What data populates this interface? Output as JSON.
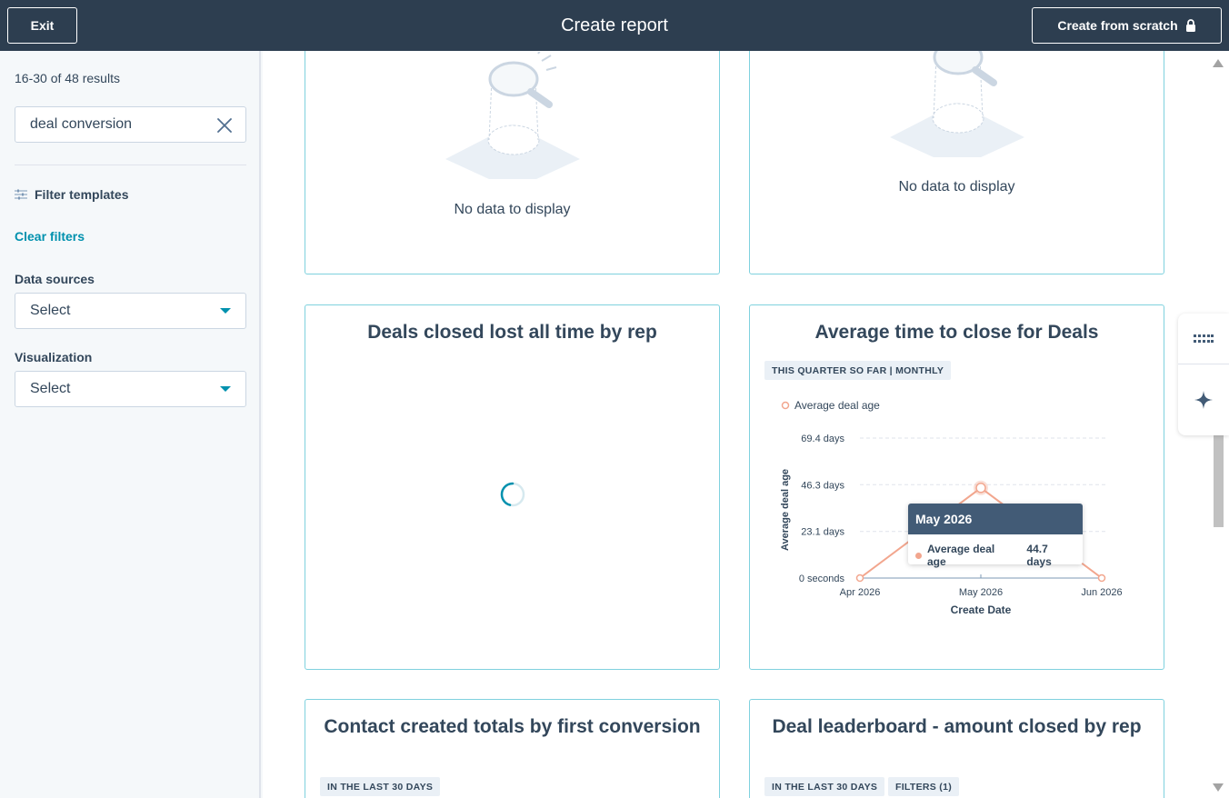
{
  "header": {
    "exit_label": "Exit",
    "title": "Create report",
    "scratch_label": "Create from scratch"
  },
  "sidebar": {
    "results_text": "16-30 of 48 results",
    "search_value": "deal conversion",
    "filter_label": "Filter templates",
    "clear_filters": "Clear filters",
    "data_sources_label": "Data sources",
    "data_sources_value": "Select",
    "visualization_label": "Visualization",
    "visualization_value": "Select"
  },
  "cards": {
    "card1": {
      "nodata": "No data to display"
    },
    "card2": {
      "nodata": "No data to display"
    },
    "card3": {
      "title": "Deals closed lost all time by rep"
    },
    "card4": {
      "title": "Average time to close for Deals",
      "chip": "THIS QUARTER SO FAR | MONTHLY",
      "legend": "Average deal age",
      "tooltip_title": "May 2026",
      "tooltip_label": "Average deal age",
      "tooltip_value": "44.7 days"
    },
    "card5": {
      "title": "Contact created totals by first conversion",
      "chip": "IN THE LAST 30 DAYS"
    },
    "card6": {
      "title": "Deal leaderboard - amount closed by rep",
      "chip1": "IN THE LAST 30 DAYS",
      "chip2": "FILTERS (1)"
    }
  },
  "chart_data": {
    "type": "line",
    "categories": [
      "Apr 2026",
      "May 2026",
      "Jun 2026"
    ],
    "series": [
      {
        "name": "Average deal age",
        "values": [
          0,
          44.7,
          0
        ]
      }
    ],
    "xlabel": "Create Date",
    "ylabel": "Average deal age",
    "yticks": [
      "0 seconds",
      "23.1 days",
      "46.3 days",
      "69.4 days"
    ],
    "ytick_values": [
      0,
      23.1,
      46.3,
      69.4
    ],
    "ylim": [
      0,
      69.4
    ],
    "grid": true,
    "color": "#f2a68e"
  },
  "colors": {
    "header_bg": "#2d3e50",
    "accent": "#0091ae",
    "card_border": "#7fd1de",
    "tooltip_bg": "#425b76"
  }
}
